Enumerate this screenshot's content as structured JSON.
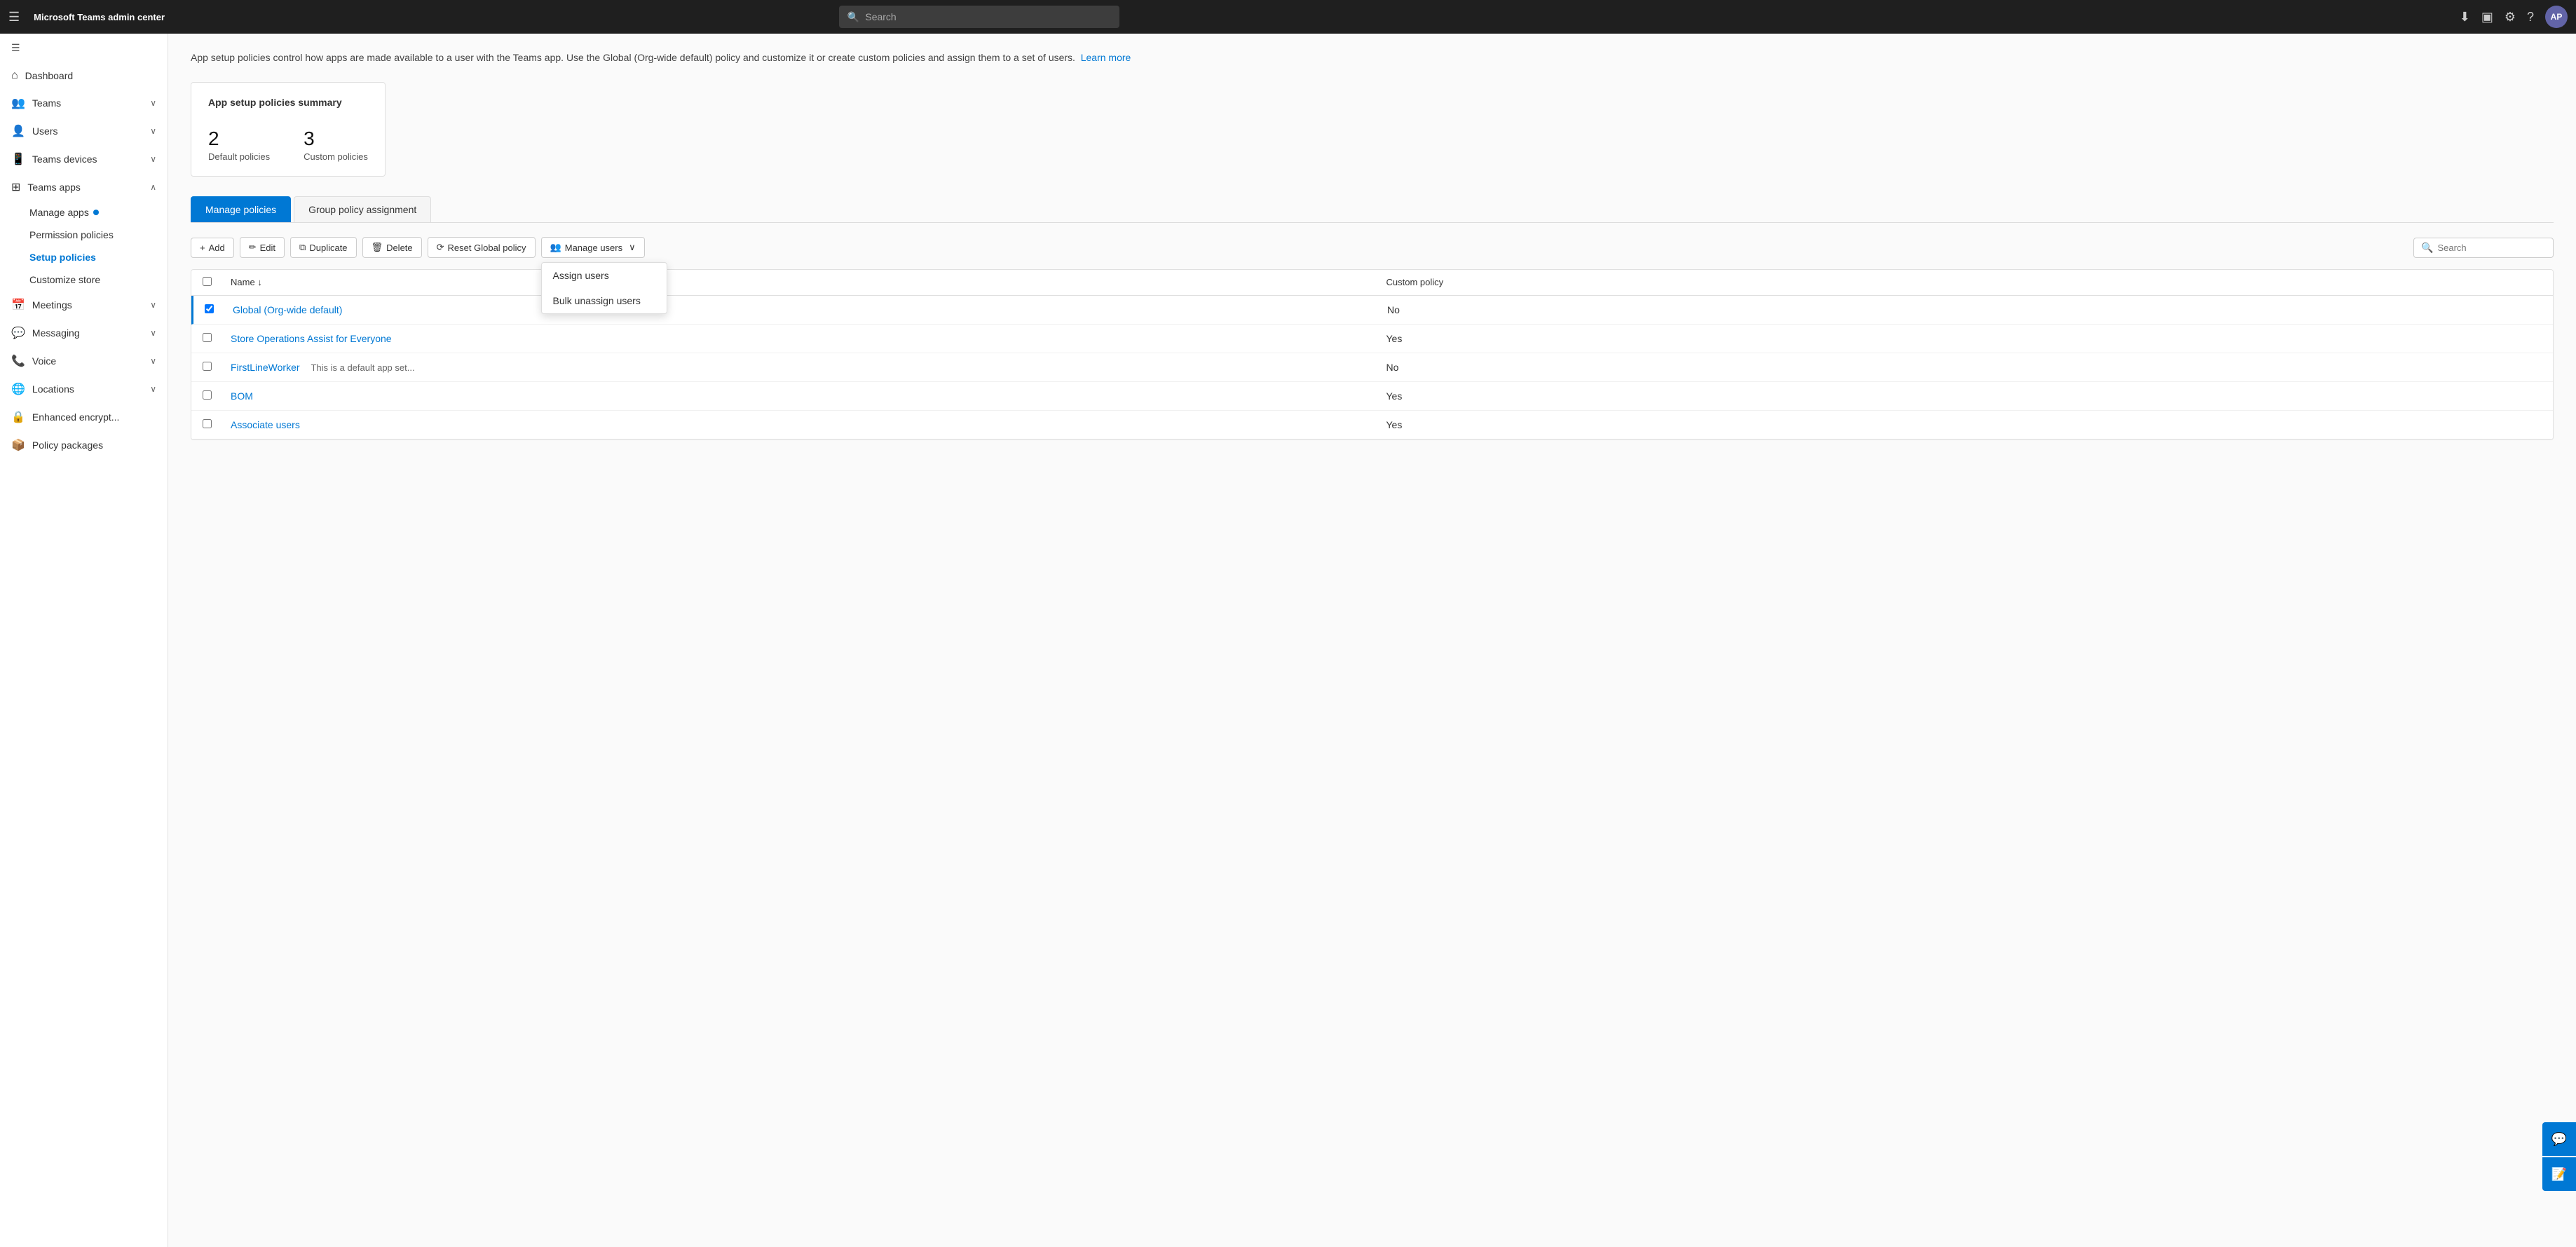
{
  "app": {
    "title": "Microsoft Teams admin center",
    "avatar_initials": "AP"
  },
  "topbar": {
    "search_placeholder": "Search",
    "hamburger_icon": "☰",
    "download_icon": "⬇",
    "monitor_icon": "🖥",
    "settings_icon": "⚙",
    "help_icon": "?"
  },
  "sidebar": {
    "collapse_icon": "☰",
    "items": [
      {
        "id": "dashboard",
        "label": "Dashboard",
        "icon": "🏠",
        "has_chevron": false
      },
      {
        "id": "teams",
        "label": "Teams",
        "icon": "👥",
        "has_chevron": true,
        "expanded": false
      },
      {
        "id": "users",
        "label": "Users",
        "icon": "👤",
        "has_chevron": true,
        "expanded": false
      },
      {
        "id": "teams-devices",
        "label": "Teams devices",
        "icon": "📱",
        "has_chevron": true,
        "expanded": false
      },
      {
        "id": "teams-apps",
        "label": "Teams apps",
        "icon": "🔲",
        "has_chevron": true,
        "expanded": true
      },
      {
        "id": "meetings",
        "label": "Meetings",
        "icon": "📅",
        "has_chevron": true,
        "expanded": false
      },
      {
        "id": "messaging",
        "label": "Messaging",
        "icon": "💬",
        "has_chevron": true,
        "expanded": false
      },
      {
        "id": "voice",
        "label": "Voice",
        "icon": "📞",
        "has_chevron": true,
        "expanded": false
      },
      {
        "id": "locations",
        "label": "Locations",
        "icon": "🌐",
        "has_chevron": true,
        "expanded": false
      },
      {
        "id": "enhanced-encrypt",
        "label": "Enhanced encrypt...",
        "icon": "🔒",
        "has_chevron": false
      },
      {
        "id": "policy-packages",
        "label": "Policy packages",
        "icon": "📦",
        "has_chevron": false
      }
    ],
    "sub_items": [
      {
        "id": "manage-apps",
        "label": "Manage apps",
        "has_dot": true,
        "active": false
      },
      {
        "id": "permission-policies",
        "label": "Permission policies",
        "active": false
      },
      {
        "id": "setup-policies",
        "label": "Setup policies",
        "active": true
      },
      {
        "id": "customize-store",
        "label": "Customize store",
        "active": false
      }
    ]
  },
  "page": {
    "description": "App setup policies control how apps are made available to a user with the Teams app. Use the Global (Org-wide default) policy and customize it or create custom policies and assign them to a set of users.",
    "learn_more_label": "Learn more"
  },
  "summary_card": {
    "title": "App setup policies summary",
    "stats": [
      {
        "number": "2",
        "label": "Default policies"
      },
      {
        "number": "3",
        "label": "Custom policies"
      }
    ]
  },
  "tabs": [
    {
      "id": "manage-policies",
      "label": "Manage policies",
      "active": true
    },
    {
      "id": "group-policy",
      "label": "Group policy assignment",
      "active": false
    }
  ],
  "toolbar": {
    "add_label": "Add",
    "edit_label": "Edit",
    "duplicate_label": "Duplicate",
    "delete_label": "Delete",
    "reset_label": "Reset Global policy",
    "manage_users_label": "Manage users",
    "chevron_down": "∨",
    "search_placeholder": "Search",
    "add_icon": "+",
    "edit_icon": "✏",
    "duplicate_icon": "⧉",
    "delete_icon": "🗑",
    "reset_icon": "⟳",
    "manage_users_icon": "👥",
    "search_icon": "🔍"
  },
  "dropdown": {
    "visible": true,
    "items": [
      {
        "id": "assign-users",
        "label": "Assign users"
      },
      {
        "id": "bulk-unassign",
        "label": "Bulk unassign users"
      }
    ]
  },
  "table": {
    "columns": [
      {
        "id": "checkbox",
        "label": ""
      },
      {
        "id": "name",
        "label": "Name",
        "sortable": true
      },
      {
        "id": "custom-policy",
        "label": "Custom policy"
      }
    ],
    "rows": [
      {
        "id": 1,
        "name": "Global (Org-wide default)",
        "description": "",
        "custom_policy": "No",
        "selected": true
      },
      {
        "id": 2,
        "name": "Store Operations Assist for Everyone",
        "description": "",
        "custom_policy": "Yes",
        "selected": false
      },
      {
        "id": 3,
        "name": "FirstLineWorker",
        "description": "This is a default app set...",
        "custom_policy": "No",
        "selected": false
      },
      {
        "id": 4,
        "name": "BOM",
        "description": "",
        "custom_policy": "Yes",
        "selected": false
      },
      {
        "id": 5,
        "name": "Associate users",
        "description": "",
        "custom_policy": "Yes",
        "selected": false
      }
    ]
  },
  "floating_btns": {
    "chat_icon": "💬",
    "feedback_icon": "📝"
  }
}
